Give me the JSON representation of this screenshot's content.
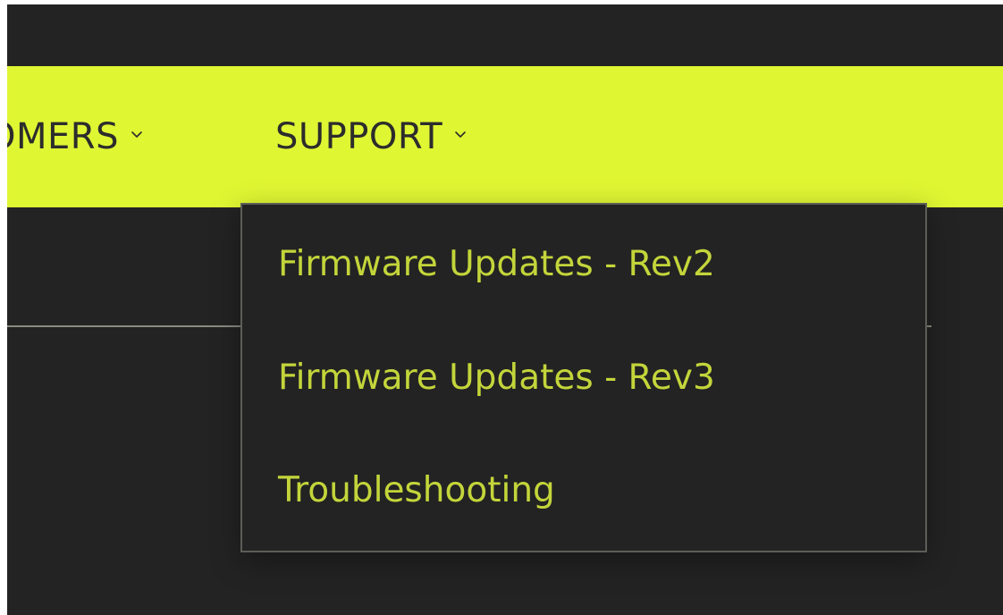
{
  "nav": {
    "items": [
      {
        "label": "OMERS",
        "icon": "chevron-down-icon"
      },
      {
        "label": "SUPPORT",
        "icon": "chevron-down-icon"
      }
    ]
  },
  "dropdown": {
    "items": [
      {
        "label": "Firmware Updates - Rev2"
      },
      {
        "label": "Firmware Updates - Rev3"
      },
      {
        "label": "Troubleshooting"
      }
    ]
  },
  "colors": {
    "background": "#232323",
    "navbar": "#dff633",
    "nav_text": "#2c2c2c",
    "dropdown_text": "#c3d53a",
    "dropdown_border": "#5d5d58"
  }
}
